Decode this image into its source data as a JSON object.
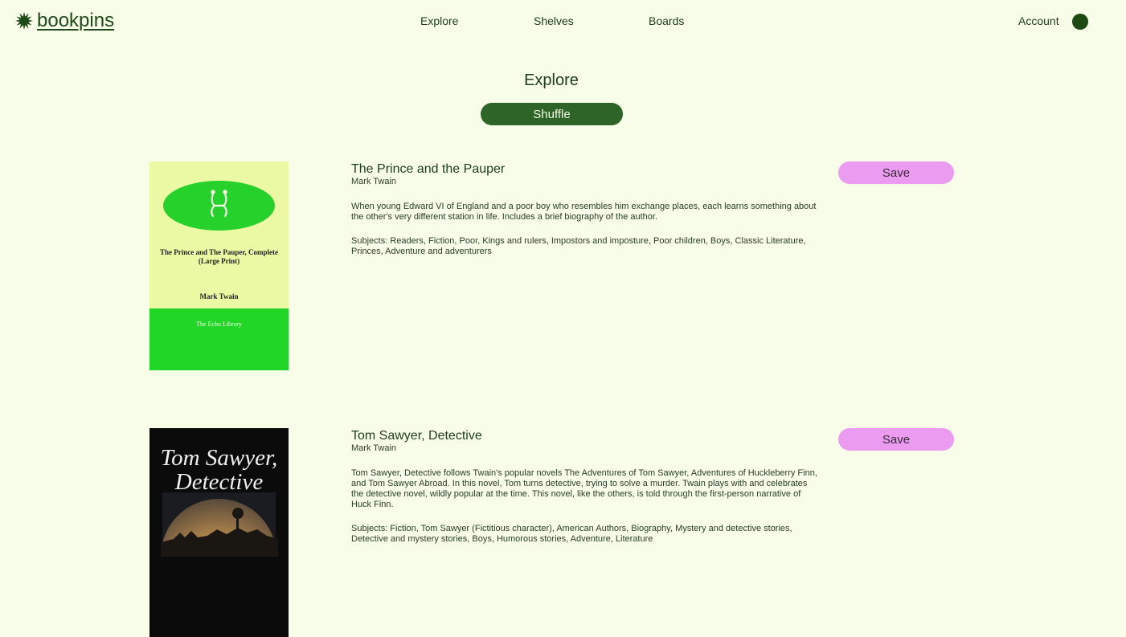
{
  "header": {
    "logo_text": "bookpins",
    "nav": [
      {
        "label": "Explore"
      },
      {
        "label": "Shelves"
      },
      {
        "label": "Boards"
      }
    ],
    "account_label": "Account"
  },
  "page": {
    "title": "Explore",
    "shuffle_label": "Shuffle"
  },
  "books": [
    {
      "title": "The Prince and the Pauper",
      "author": "Mark Twain",
      "description": "When young Edward VI of England and a poor boy who resembles him exchange places, each learns something about the other's very different station in life. Includes a brief biography of the author.",
      "subjects": "Subjects: Readers, Fiction, Poor, Kings and rulers, Impostors and imposture, Poor children, Boys, Classic Literature, Princes, Adventure and adventurers",
      "save_label": "Save",
      "cover": {
        "title": "The Prince and The Pauper, Complete (Large Print)",
        "author": "Mark Twain",
        "publisher": "The Echo Library"
      }
    },
    {
      "title": "Tom Sawyer, Detective",
      "author": "Mark Twain",
      "description": "Tom Sawyer, Detective follows Twain's popular novels The Adventures of Tom Sawyer, Adventures of Huckleberry Finn, and Tom Sawyer Abroad. In this novel, Tom turns detective, trying to solve a murder. Twain plays with and celebrates the detective novel, wildly popular at the time. This novel, like the others, is told through the first-person narrative of Huck Finn.",
      "subjects": "Subjects: Fiction, Tom Sawyer (Fictitious character), American Authors, Biography, Mystery and detective stories, Detective and mystery stories, Boys, Humorous stories, Adventure, Literature",
      "save_label": "Save",
      "cover": {
        "title": "Tom Sawyer, Detective"
      }
    }
  ]
}
